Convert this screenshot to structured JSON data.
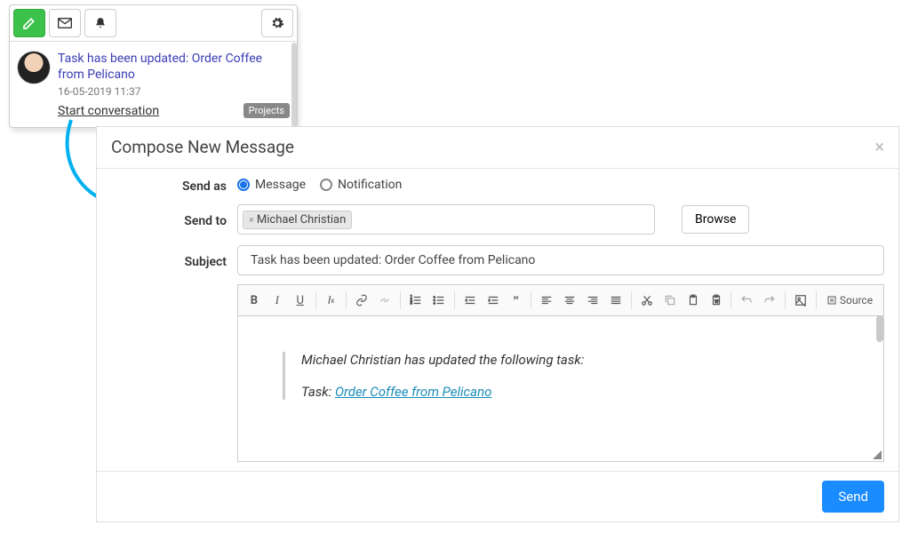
{
  "notification": {
    "title": "Task has been updated: Order Coffee from Pelicano",
    "timestamp": "16-05-2019 11:37",
    "action_link": "Start conversation",
    "badge": "Projects"
  },
  "compose": {
    "title": "Compose New Message",
    "labels": {
      "send_as": "Send as",
      "send_to": "Send to",
      "subject": "Subject"
    },
    "send_as_options": {
      "message": "Message",
      "notification": "Notification",
      "selected": "message"
    },
    "recipient_token": "Michael Christian",
    "browse_label": "Browse",
    "subject_value": "Task has been updated: Order Coffee from Pelicano",
    "body": {
      "line1": "Michael Christian has updated the following task:",
      "task_prefix": "Task: ",
      "task_link": "Order Coffee from Pelicano"
    },
    "source_label": "Source",
    "send_label": "Send"
  }
}
